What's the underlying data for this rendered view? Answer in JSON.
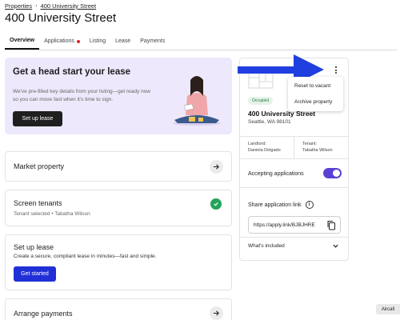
{
  "breadcrumb": {
    "root": "Properties",
    "current": "400 University Street"
  },
  "page_title": "400 University Street",
  "tabs": [
    {
      "label": "Overview",
      "active": true
    },
    {
      "label": "Applications",
      "badge": true
    },
    {
      "label": "Listing"
    },
    {
      "label": "Lease"
    },
    {
      "label": "Payments"
    }
  ],
  "hero": {
    "title": "Get a head start your lease",
    "body": "We've pre-filled key details from your listing—get ready now so you can move fast when it's time to sign.",
    "button": "Set up lease"
  },
  "cards": {
    "market": {
      "title": "Market property"
    },
    "screen": {
      "title": "Screen tenants",
      "subtitle": "Tenant selected • Tabatha Wilson"
    },
    "lease": {
      "title": "Set up lease",
      "subtitle": "Create a secure, compliant lease in minutes—fast and simple.",
      "button": "Get started"
    },
    "payments": {
      "title": "Arrange payments"
    }
  },
  "panel": {
    "status": "Occupied",
    "address": "400 University Street",
    "city": "Seattle, WA 98101",
    "landlord_label": "Landlord:",
    "landlord_name": "Daniela Delgado",
    "tenant_label": "Tenant:",
    "tenant_name": "Tabatha Wilson",
    "accepting_label": "Accepting applications",
    "accepting_on": true,
    "share_label": "Share application link",
    "share_link": "https://apply.link/BJBJHRE",
    "included_label": "What's included"
  },
  "menu": {
    "items": [
      "Reset to vacant",
      "Archive property"
    ]
  },
  "widget": {
    "label": "Aircall"
  },
  "colors": {
    "accent": "#5b3fd6",
    "primary_button": "#2030d6",
    "hero_bg": "#ede8fb",
    "success": "#22a55a",
    "annotation_arrow": "#1f3fe0"
  }
}
